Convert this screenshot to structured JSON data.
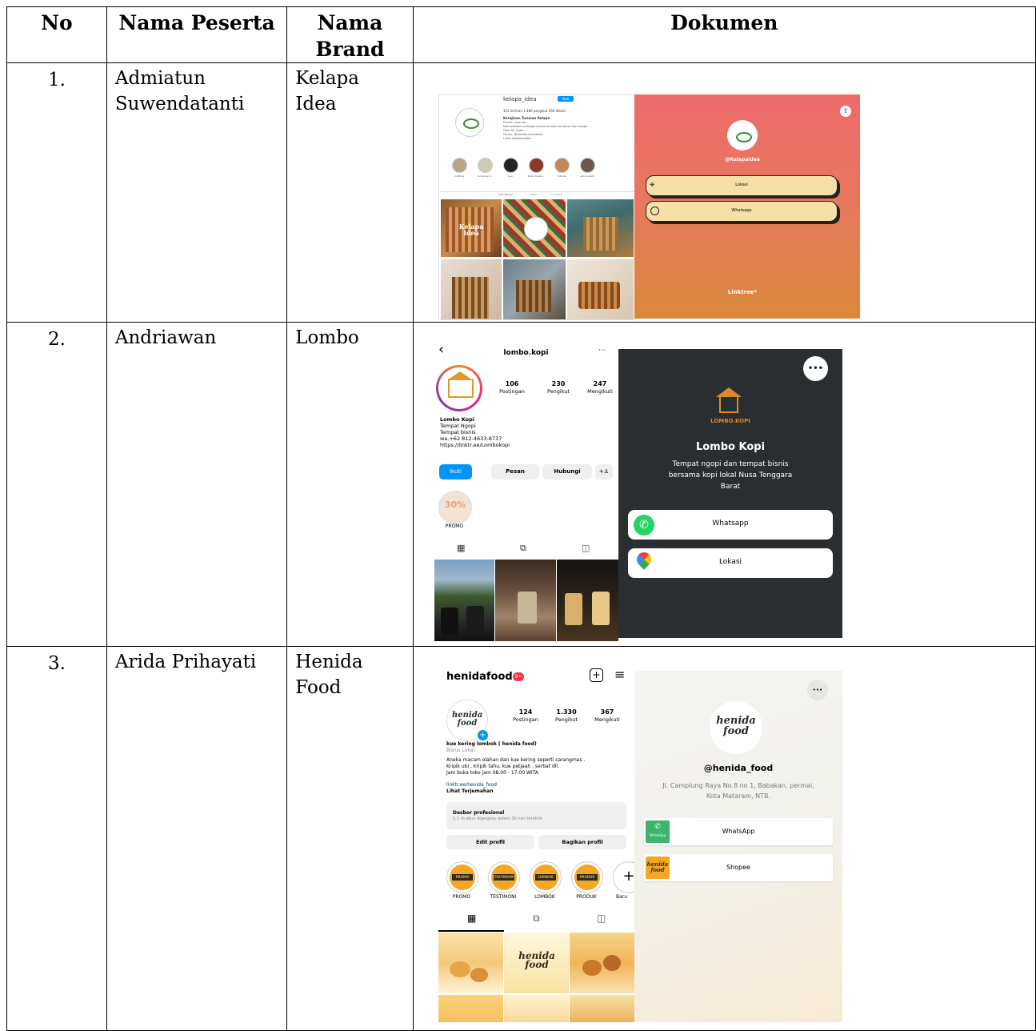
{
  "headers": {
    "no": "No",
    "nama_peserta": "Nama Peserta",
    "nama_brand": "Nama Brand",
    "dokumen": "Dokumen"
  },
  "rows": [
    {
      "no": "1.",
      "nama": "Admiatun Suwendatanti",
      "brand": "Kelapa Idea"
    },
    {
      "no": "2.",
      "nama": "Andriawan",
      "brand": "Lombo"
    },
    {
      "no": "3.",
      "nama": "Arida Prihayati",
      "brand": "Henida Food"
    }
  ],
  "doc1": {
    "ig_handle": "kelapa_idea",
    "ig_follow": "Ikuti",
    "ig_stats": "112 kiriman   1.480 pengikut   356 diikuti",
    "ig_bio_name": "Kerajinan Turunan Kelapa",
    "ig_bio": "Produk Layanan\nMenyediakan berbagai macam produk kerajinan dari kelapa\nOffer for Order…\nOwner: @admiatunsuwende\nLinktr.ee/kelapaidea",
    "highlights": [
      "Crafting",
      "Company P...",
      "Jual",
      "Daily Sustai...",
      "Tutorial",
      "ada inisiatif"
    ],
    "tabs": [
      "POSTINGAN",
      "REELS",
      "DITANDAI"
    ],
    "grid_text": "Kelapa Idea",
    "lt_handle": "@Kelapaidea",
    "lt_links": [
      "Lokasi",
      "Whatsapp"
    ],
    "lt_footer": "Linktree*"
  },
  "doc2": {
    "ig_handle": "lombo.kopi",
    "stats": [
      {
        "n": "106",
        "l": "Postingan"
      },
      {
        "n": "230",
        "l": "Pengikut"
      },
      {
        "n": "247",
        "l": "Mengikuti"
      }
    ],
    "bio": [
      "Lombo Kopi",
      "Tempat Ngopi",
      "Tempat bisnis",
      "wa.+62 812-4633-8737",
      "https://linktr.ee/Lombokopi"
    ],
    "buttons": [
      "Ikuti",
      "Pesan",
      "Hubungi"
    ],
    "highlight": "PROMO",
    "highlight_badge": "30%",
    "lt_logo_text": "LOMBO.KOPI",
    "lt_title": "Lombo Kopi",
    "lt_desc": "Tempat ngopi dan tempat bisnis bersama kopi lokal Nusa Tenggara Barat",
    "lt_links": [
      "Whatsapp",
      "Lokasi"
    ],
    "menu": "•••",
    "back": "‹"
  },
  "doc3": {
    "ig_handle": "henidafood",
    "badge": "9+",
    "stats": [
      {
        "n": "124",
        "l": "Postingan"
      },
      {
        "n": "1.330",
        "l": "Pengikut"
      },
      {
        "n": "367",
        "l": "Mengikuti"
      }
    ],
    "bio_name": "kue kering lombok ( henida food)",
    "bio_cat": "Bisnis Lokal",
    "bio_lines": [
      "Aneka macam olahan dan kue kering seperti carangmas .",
      "Kripik ubi , kripik tahu, kue petjaah , serbat dll.",
      "Jam buka toko jam 08.00 - 17.00 WITA"
    ],
    "bio_link": "linktr.ee/henida_food",
    "bio_translate": "Lihat Terjemahan",
    "dash_title": "Dasbor profesional",
    "dash_sub": "1,1 rb akun dijangkau dalam 30 hari terakhir.",
    "btn_edit": "Edit profil",
    "btn_share": "Bagikan profil",
    "highlights": [
      {
        "badge": "PROMO",
        "label": "PROMO"
      },
      {
        "badge": "TESTIMONI",
        "label": "TESTIMONI"
      },
      {
        "badge": "LOMBOK",
        "label": "LOMBOK"
      },
      {
        "badge": "PRODUK",
        "label": "PRODUK"
      }
    ],
    "hl_new": "Baru",
    "logo_text": "henida food",
    "lt_handle": "@henida_food",
    "lt_addr": "Jl. Camplung Raya No.8 no 1, Babakan, permai, Kota Mataram, NTB.",
    "lt_links": [
      "WhatsApp",
      "Shopee"
    ],
    "wa_small": "WhatsApp",
    "menu": "•••"
  },
  "colors": {
    "ig_blue": "#0095f6",
    "lt1_top": "#ec6b6b",
    "lt1_bottom": "#d9893b",
    "lt1_btn": "#f6e0a8",
    "lt2_bg": "#2b2e30",
    "wa_green": "#25d366",
    "henida_orange": "#f5a623"
  }
}
